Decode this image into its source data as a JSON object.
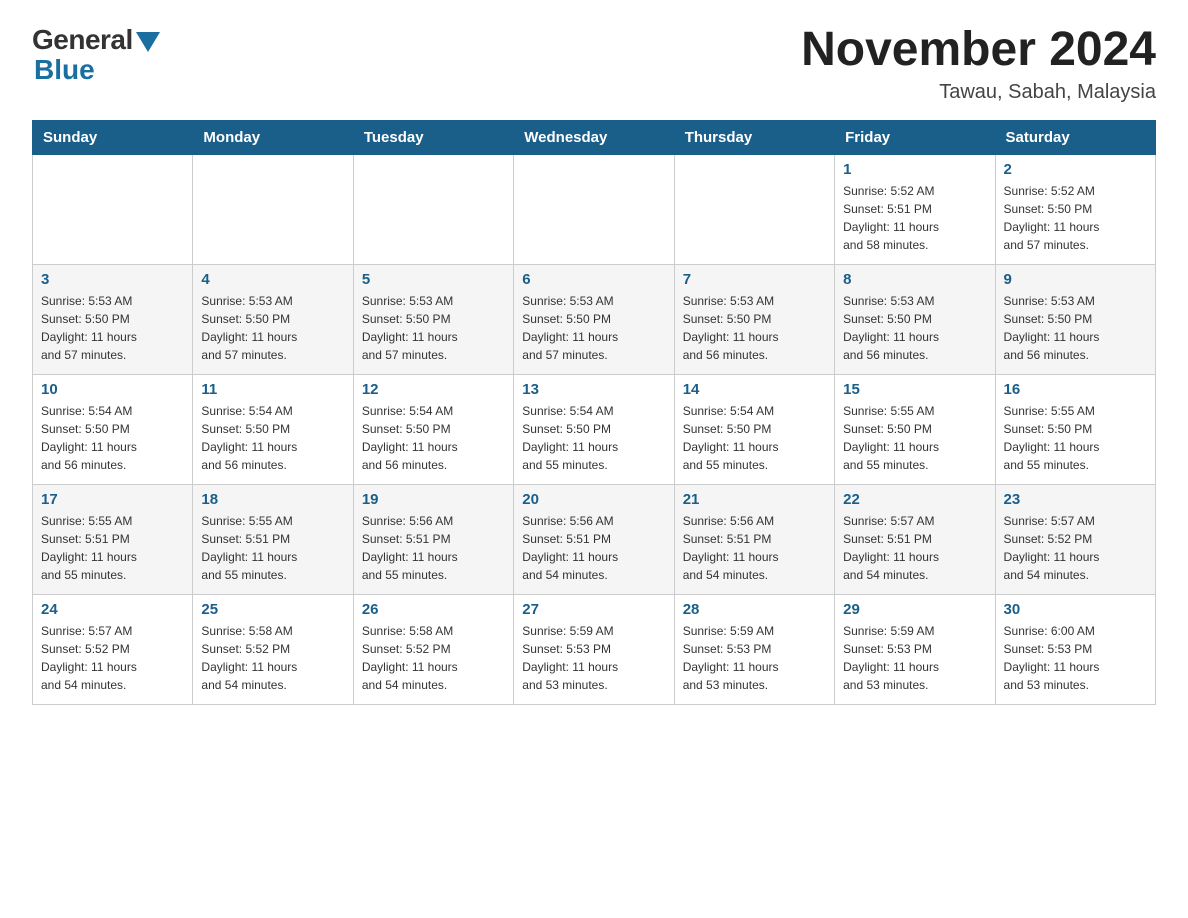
{
  "logo": {
    "general_text": "General",
    "blue_text": "Blue"
  },
  "title": {
    "month_year": "November 2024",
    "location": "Tawau, Sabah, Malaysia"
  },
  "weekdays": [
    "Sunday",
    "Monday",
    "Tuesday",
    "Wednesday",
    "Thursday",
    "Friday",
    "Saturday"
  ],
  "weeks": [
    [
      {
        "day": "",
        "info": ""
      },
      {
        "day": "",
        "info": ""
      },
      {
        "day": "",
        "info": ""
      },
      {
        "day": "",
        "info": ""
      },
      {
        "day": "",
        "info": ""
      },
      {
        "day": "1",
        "info": "Sunrise: 5:52 AM\nSunset: 5:51 PM\nDaylight: 11 hours\nand 58 minutes."
      },
      {
        "day": "2",
        "info": "Sunrise: 5:52 AM\nSunset: 5:50 PM\nDaylight: 11 hours\nand 57 minutes."
      }
    ],
    [
      {
        "day": "3",
        "info": "Sunrise: 5:53 AM\nSunset: 5:50 PM\nDaylight: 11 hours\nand 57 minutes."
      },
      {
        "day": "4",
        "info": "Sunrise: 5:53 AM\nSunset: 5:50 PM\nDaylight: 11 hours\nand 57 minutes."
      },
      {
        "day": "5",
        "info": "Sunrise: 5:53 AM\nSunset: 5:50 PM\nDaylight: 11 hours\nand 57 minutes."
      },
      {
        "day": "6",
        "info": "Sunrise: 5:53 AM\nSunset: 5:50 PM\nDaylight: 11 hours\nand 57 minutes."
      },
      {
        "day": "7",
        "info": "Sunrise: 5:53 AM\nSunset: 5:50 PM\nDaylight: 11 hours\nand 56 minutes."
      },
      {
        "day": "8",
        "info": "Sunrise: 5:53 AM\nSunset: 5:50 PM\nDaylight: 11 hours\nand 56 minutes."
      },
      {
        "day": "9",
        "info": "Sunrise: 5:53 AM\nSunset: 5:50 PM\nDaylight: 11 hours\nand 56 minutes."
      }
    ],
    [
      {
        "day": "10",
        "info": "Sunrise: 5:54 AM\nSunset: 5:50 PM\nDaylight: 11 hours\nand 56 minutes."
      },
      {
        "day": "11",
        "info": "Sunrise: 5:54 AM\nSunset: 5:50 PM\nDaylight: 11 hours\nand 56 minutes."
      },
      {
        "day": "12",
        "info": "Sunrise: 5:54 AM\nSunset: 5:50 PM\nDaylight: 11 hours\nand 56 minutes."
      },
      {
        "day": "13",
        "info": "Sunrise: 5:54 AM\nSunset: 5:50 PM\nDaylight: 11 hours\nand 55 minutes."
      },
      {
        "day": "14",
        "info": "Sunrise: 5:54 AM\nSunset: 5:50 PM\nDaylight: 11 hours\nand 55 minutes."
      },
      {
        "day": "15",
        "info": "Sunrise: 5:55 AM\nSunset: 5:50 PM\nDaylight: 11 hours\nand 55 minutes."
      },
      {
        "day": "16",
        "info": "Sunrise: 5:55 AM\nSunset: 5:50 PM\nDaylight: 11 hours\nand 55 minutes."
      }
    ],
    [
      {
        "day": "17",
        "info": "Sunrise: 5:55 AM\nSunset: 5:51 PM\nDaylight: 11 hours\nand 55 minutes."
      },
      {
        "day": "18",
        "info": "Sunrise: 5:55 AM\nSunset: 5:51 PM\nDaylight: 11 hours\nand 55 minutes."
      },
      {
        "day": "19",
        "info": "Sunrise: 5:56 AM\nSunset: 5:51 PM\nDaylight: 11 hours\nand 55 minutes."
      },
      {
        "day": "20",
        "info": "Sunrise: 5:56 AM\nSunset: 5:51 PM\nDaylight: 11 hours\nand 54 minutes."
      },
      {
        "day": "21",
        "info": "Sunrise: 5:56 AM\nSunset: 5:51 PM\nDaylight: 11 hours\nand 54 minutes."
      },
      {
        "day": "22",
        "info": "Sunrise: 5:57 AM\nSunset: 5:51 PM\nDaylight: 11 hours\nand 54 minutes."
      },
      {
        "day": "23",
        "info": "Sunrise: 5:57 AM\nSunset: 5:52 PM\nDaylight: 11 hours\nand 54 minutes."
      }
    ],
    [
      {
        "day": "24",
        "info": "Sunrise: 5:57 AM\nSunset: 5:52 PM\nDaylight: 11 hours\nand 54 minutes."
      },
      {
        "day": "25",
        "info": "Sunrise: 5:58 AM\nSunset: 5:52 PM\nDaylight: 11 hours\nand 54 minutes."
      },
      {
        "day": "26",
        "info": "Sunrise: 5:58 AM\nSunset: 5:52 PM\nDaylight: 11 hours\nand 54 minutes."
      },
      {
        "day": "27",
        "info": "Sunrise: 5:59 AM\nSunset: 5:53 PM\nDaylight: 11 hours\nand 53 minutes."
      },
      {
        "day": "28",
        "info": "Sunrise: 5:59 AM\nSunset: 5:53 PM\nDaylight: 11 hours\nand 53 minutes."
      },
      {
        "day": "29",
        "info": "Sunrise: 5:59 AM\nSunset: 5:53 PM\nDaylight: 11 hours\nand 53 minutes."
      },
      {
        "day": "30",
        "info": "Sunrise: 6:00 AM\nSunset: 5:53 PM\nDaylight: 11 hours\nand 53 minutes."
      }
    ]
  ]
}
